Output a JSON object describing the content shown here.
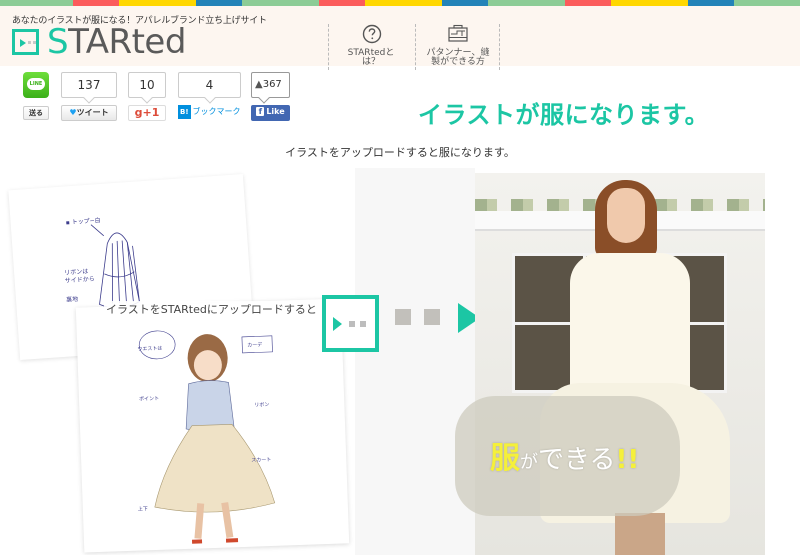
{
  "header": {
    "stripe_colors": [
      "#8ccc96",
      "#fb5c5c",
      "#ffd700",
      "#2383b8",
      "#8ccc96",
      "#fb5c5c",
      "#ffd700",
      "#2383b8",
      "#8ccc96",
      "#fb5c5c",
      "#ffd700",
      "#2383b8",
      "#8ccc96"
    ],
    "tagline": "あなたのイラストが服になる！アパレルブランド立ち上げサイト",
    "logo_first": "S",
    "logo_rest": "TARted",
    "nav": [
      {
        "label": "STARtedとは？",
        "icon": "question-circle-icon"
      },
      {
        "label": "パタンナー、縫製ができる方",
        "icon": "sewing-machine-icon"
      }
    ]
  },
  "social": {
    "line_icon_text": "LINE",
    "line_send": "送る",
    "tweet_count": "137",
    "tweet_label": "ツイート",
    "gplus_count": "10",
    "gplus_label": "g+1",
    "hatena_count": "4",
    "hatena_badge": "B!",
    "hatena_label": "ブックマーク",
    "fb_count": "367",
    "fb_label": "Like"
  },
  "main": {
    "headline": "イラストが服になります。",
    "subline": "イラストをアップロードすると服になります。",
    "upload_caption": "イラストをSTARtedにアップロードすると",
    "result_main": "服",
    "result_particle": "が",
    "result_rest": "できる",
    "result_exclaim": "!!"
  },
  "colors": {
    "accent": "#1cc6a4",
    "header_bg": "#fdf6f0",
    "logo_gray": "#5a5a5a"
  }
}
